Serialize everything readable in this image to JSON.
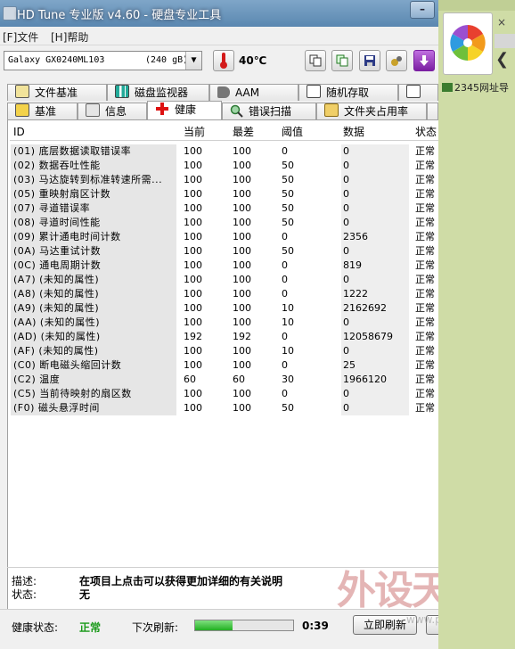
{
  "window": {
    "title": "HD Tune 专业版 v4.60 - 硬盘专业工具",
    "minimize_label": "–"
  },
  "menu": [
    {
      "label": "[F]文件"
    },
    {
      "label": "[H]帮助"
    }
  ],
  "toolbar": {
    "drive_name": "Galaxy GX0240ML103",
    "drive_capacity": "(240 gB)",
    "dropdown_arrow": "▼",
    "temperature": "40℃"
  },
  "tabs_row1": [
    {
      "label": "文件基准",
      "icon": "file-benchmark-icon"
    },
    {
      "label": "磁盘监视器",
      "icon": "disk-monitor-icon"
    },
    {
      "label": "AAM",
      "icon": "speaker-icon"
    },
    {
      "label": "随机存取",
      "icon": "random-access-icon"
    },
    {
      "label": "",
      "icon": "extra-tests-icon"
    }
  ],
  "tabs_row2": [
    {
      "label": "基准",
      "icon": "benchmark-icon"
    },
    {
      "label": "信息",
      "icon": "info-icon"
    },
    {
      "label": "健康",
      "icon": "health-cross-icon",
      "active": true
    },
    {
      "label": "错误扫描",
      "icon": "magnifier-icon"
    },
    {
      "label": "文件夹占用率",
      "icon": "folder-icon"
    }
  ],
  "table": {
    "headers": {
      "id": "ID",
      "current": "当前",
      "worst": "最差",
      "threshold": "阈值",
      "data": "数据",
      "status": "状态"
    },
    "rows": [
      {
        "name": "(01) 底层数据读取错误率",
        "current": "100",
        "worst": "100",
        "threshold": "0",
        "data": "0",
        "status": "正常"
      },
      {
        "name": "(02) 数据吞吐性能",
        "current": "100",
        "worst": "100",
        "threshold": "50",
        "data": "0",
        "status": "正常"
      },
      {
        "name": "(03) 马达旋转到标准转速所需...",
        "current": "100",
        "worst": "100",
        "threshold": "50",
        "data": "0",
        "status": "正常"
      },
      {
        "name": "(05) 重映射扇区计数",
        "current": "100",
        "worst": "100",
        "threshold": "50",
        "data": "0",
        "status": "正常"
      },
      {
        "name": "(07) 寻道错误率",
        "current": "100",
        "worst": "100",
        "threshold": "50",
        "data": "0",
        "status": "正常"
      },
      {
        "name": "(08) 寻道时间性能",
        "current": "100",
        "worst": "100",
        "threshold": "50",
        "data": "0",
        "status": "正常"
      },
      {
        "name": "(09) 累计通电时间计数",
        "current": "100",
        "worst": "100",
        "threshold": "0",
        "data": "2356",
        "status": "正常"
      },
      {
        "name": "(0A) 马达重试计数",
        "current": "100",
        "worst": "100",
        "threshold": "50",
        "data": "0",
        "status": "正常"
      },
      {
        "name": "(0C) 通电周期计数",
        "current": "100",
        "worst": "100",
        "threshold": "0",
        "data": "819",
        "status": "正常"
      },
      {
        "name": "(A7) (未知的属性)",
        "current": "100",
        "worst": "100",
        "threshold": "0",
        "data": "0",
        "status": "正常"
      },
      {
        "name": "(A8) (未知的属性)",
        "current": "100",
        "worst": "100",
        "threshold": "0",
        "data": "1222",
        "status": "正常"
      },
      {
        "name": "(A9) (未知的属性)",
        "current": "100",
        "worst": "100",
        "threshold": "10",
        "data": "2162692",
        "status": "正常"
      },
      {
        "name": "(AA) (未知的属性)",
        "current": "100",
        "worst": "100",
        "threshold": "10",
        "data": "0",
        "status": "正常"
      },
      {
        "name": "(AD) (未知的属性)",
        "current": "192",
        "worst": "192",
        "threshold": "0",
        "data": "12058679",
        "status": "正常"
      },
      {
        "name": "(AF) (未知的属性)",
        "current": "100",
        "worst": "100",
        "threshold": "10",
        "data": "0",
        "status": "正常"
      },
      {
        "name": "(C0) 断电磁头缩回计数",
        "current": "100",
        "worst": "100",
        "threshold": "0",
        "data": "25",
        "status": "正常"
      },
      {
        "name": "(C2) 温度",
        "current": "60",
        "worst": "60",
        "threshold": "30",
        "data": "1966120",
        "status": "正常"
      },
      {
        "name": "(C5) 当前待映射的扇区数",
        "current": "100",
        "worst": "100",
        "threshold": "0",
        "data": "0",
        "status": "正常"
      },
      {
        "name": "(F0) 磁头悬浮时间",
        "current": "100",
        "worst": "100",
        "threshold": "50",
        "data": "0",
        "status": "正常"
      }
    ]
  },
  "details": {
    "description_label": "描述:",
    "description_value": "在项目上点击可以获得更加详细的有关说明",
    "status_label": "状态:",
    "status_value": "无"
  },
  "statusbar": {
    "health_label": "健康状态:",
    "health_value": "正常",
    "health_color": "#1a9a1a",
    "next_refresh_label": "下次刷新:",
    "refresh_progress": 0.38,
    "countdown": "0:39",
    "refresh_button": "立即刷新"
  },
  "side_panel": {
    "close_label": "×",
    "back_arrow": "❮",
    "link_label": "2345网址导"
  },
  "watermark": {
    "text": "外设天下",
    "url": "www.pcwaishe.cn"
  }
}
